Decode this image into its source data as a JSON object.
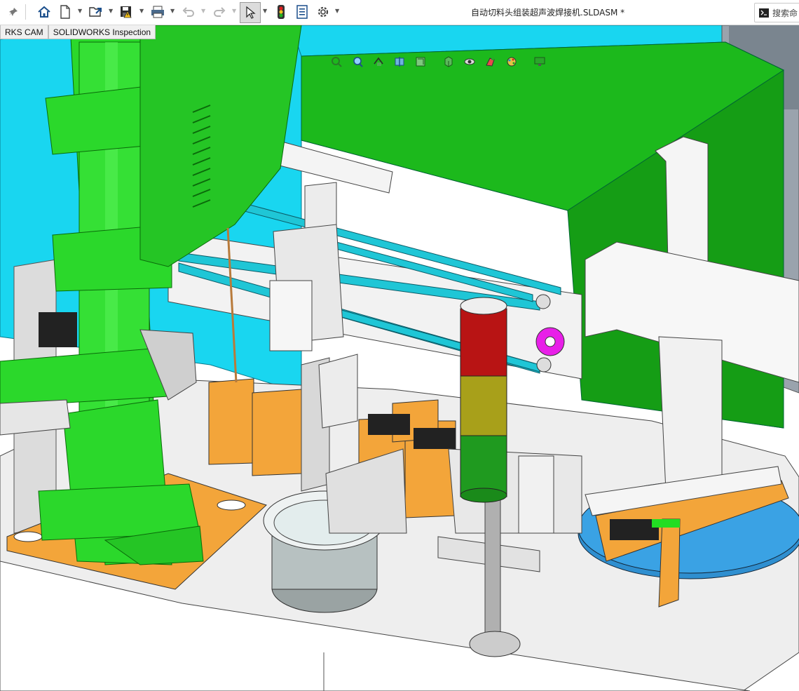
{
  "window": {
    "title": "自动切料头组装超声波焊接机.SLDASM *"
  },
  "search": {
    "label": "搜索命"
  },
  "tabs": [
    {
      "label": "RKS CAM"
    },
    {
      "label": "SOLIDWORKS Inspection"
    }
  ],
  "toolbar": {
    "icons": [
      "pin-icon",
      "home-icon",
      "new-document-icon",
      "open-icon",
      "save-icon",
      "print-icon",
      "undo-icon",
      "redo-icon",
      "select-icon",
      "rebuild-icon",
      "file-properties-icon",
      "options-icon"
    ]
  },
  "heads_up": {
    "icons": [
      "zoom-to-fit-icon",
      "zoom-area-icon",
      "previous-view-icon",
      "section-view-icon",
      "dynamic-annotation-icon",
      "view-orientation-icon",
      "display-style-icon",
      "hide-show-icon",
      "edit-appearance-icon",
      "apply-scene-icon",
      "view-settings-icon"
    ]
  },
  "colors": {
    "machine_green": "#2bd82b",
    "panel_green": "#16a316",
    "cyan_wall": "#19d6f0",
    "orange_parts": "#f3a53a",
    "base_gray": "#e6e6e6",
    "tower_red": "#b81414",
    "tower_yellow": "#a8a01a",
    "tower_green": "#1f9a1f",
    "turntable_blue": "#2f8fd0"
  }
}
